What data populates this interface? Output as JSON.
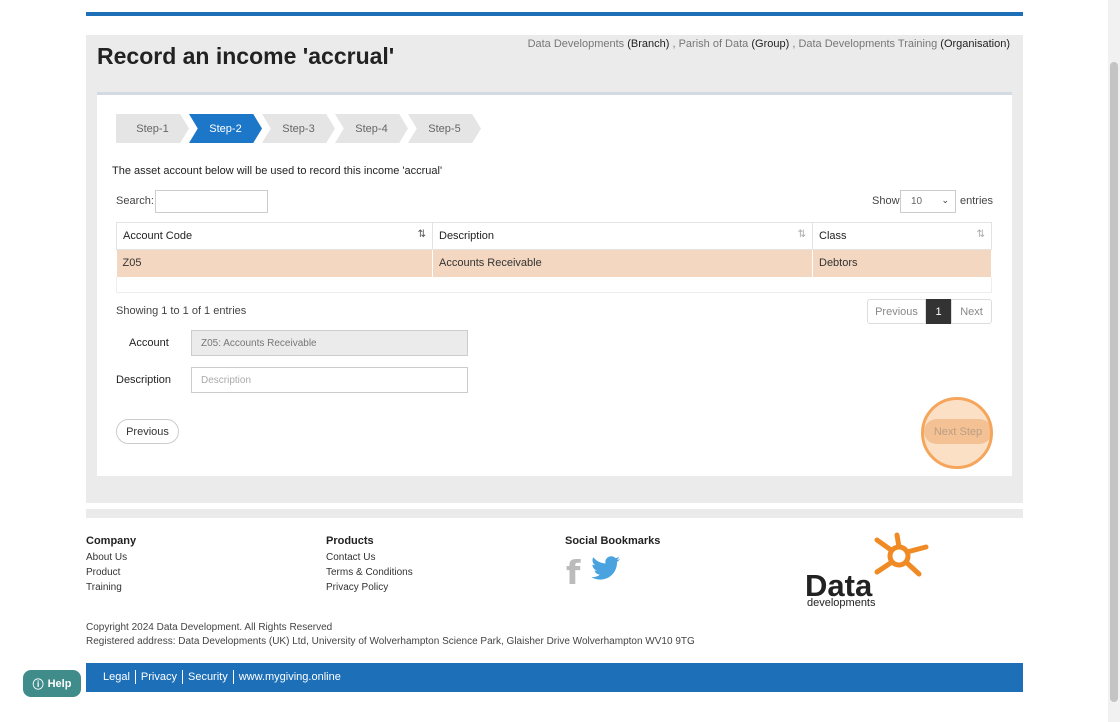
{
  "page": {
    "title": "Record an income 'accrual'"
  },
  "context": [
    {
      "name": "Data Developments",
      "type": "(Branch)"
    },
    {
      "name": "Parish of Data",
      "type": "(Group)"
    },
    {
      "name": "Data Developments Training",
      "type": "(Organisation)"
    }
  ],
  "steps": [
    "Step-1",
    "Step-2",
    "Step-3",
    "Step-4",
    "Step-5"
  ],
  "active_step": "Step-2",
  "info": "The asset account below will be used to record this income 'accrual'",
  "search": {
    "label": "Search:",
    "value": ""
  },
  "length": {
    "show": "Show",
    "value": "10",
    "entries": "entries"
  },
  "table": {
    "headers": [
      "Account Code",
      "Description",
      "Class"
    ],
    "rows": [
      [
        "Z05",
        "Accounts Receivable",
        "Debtors"
      ]
    ]
  },
  "showing": "Showing 1 to 1 of 1 entries",
  "pager": {
    "prev": "Previous",
    "page": "1",
    "next": "Next"
  },
  "form": {
    "account_label": "Account",
    "account_value": "Z05: Accounts Receivable",
    "description_label": "Description",
    "description_placeholder": "Description"
  },
  "buttons": {
    "previous": "Previous",
    "next_step": "Next Step"
  },
  "footer": {
    "company": {
      "title": "Company",
      "links": [
        "About Us",
        "Product",
        "Training"
      ]
    },
    "products": {
      "title": "Products",
      "links": [
        "Contact Us",
        "Terms & Conditions",
        "Privacy Policy"
      ]
    },
    "social": {
      "title": "Social Bookmarks",
      "icons": [
        "facebook-icon",
        "twitter-icon"
      ]
    },
    "logo": {
      "word": "Data",
      "sub": "developments"
    },
    "copyright": "Copyright 2024 Data Development. All Rights Reserved",
    "address": "Registered address: Data Developments (UK) Ltd, University of Wolverhampton Science Park, Glaisher Drive Wolverhampton WV10 9TG",
    "bottom_links": [
      "Legal",
      "Privacy",
      "Security",
      "www.mygiving.online"
    ]
  },
  "help": {
    "label": "Help"
  },
  "colors": {
    "primary": "#1d6fb8",
    "selected_row": "#f3d7c0",
    "highlight": "#f5a65c",
    "help": "#3f8c8a"
  }
}
